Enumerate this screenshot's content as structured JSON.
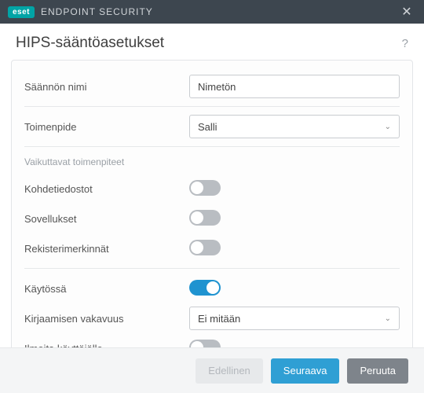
{
  "titlebar": {
    "brand_badge": "eset",
    "brand_name": "ENDPOINT SECURITY"
  },
  "header": {
    "title": "HIPS-sääntöasetukset",
    "help_symbol": "?"
  },
  "form": {
    "rule_name_label": "Säännön nimi",
    "rule_name_value": "Nimetön",
    "action_label": "Toimenpide",
    "action_value": "Salli",
    "section_affecting": "Vaikuttavat toimenpiteet",
    "target_files_label": "Kohdetiedostot",
    "target_files_on": false,
    "applications_label": "Sovellukset",
    "applications_on": false,
    "registry_label": "Rekisterimerkinnät",
    "registry_on": false,
    "enabled_label": "Käytössä",
    "enabled_on": true,
    "log_severity_label": "Kirjaamisen vakavuus",
    "log_severity_value": "Ei mitään",
    "notify_label": "Ilmoita käyttäjälle",
    "notify_on": false
  },
  "footer": {
    "previous": "Edellinen",
    "next": "Seuraava",
    "cancel": "Peruuta"
  }
}
